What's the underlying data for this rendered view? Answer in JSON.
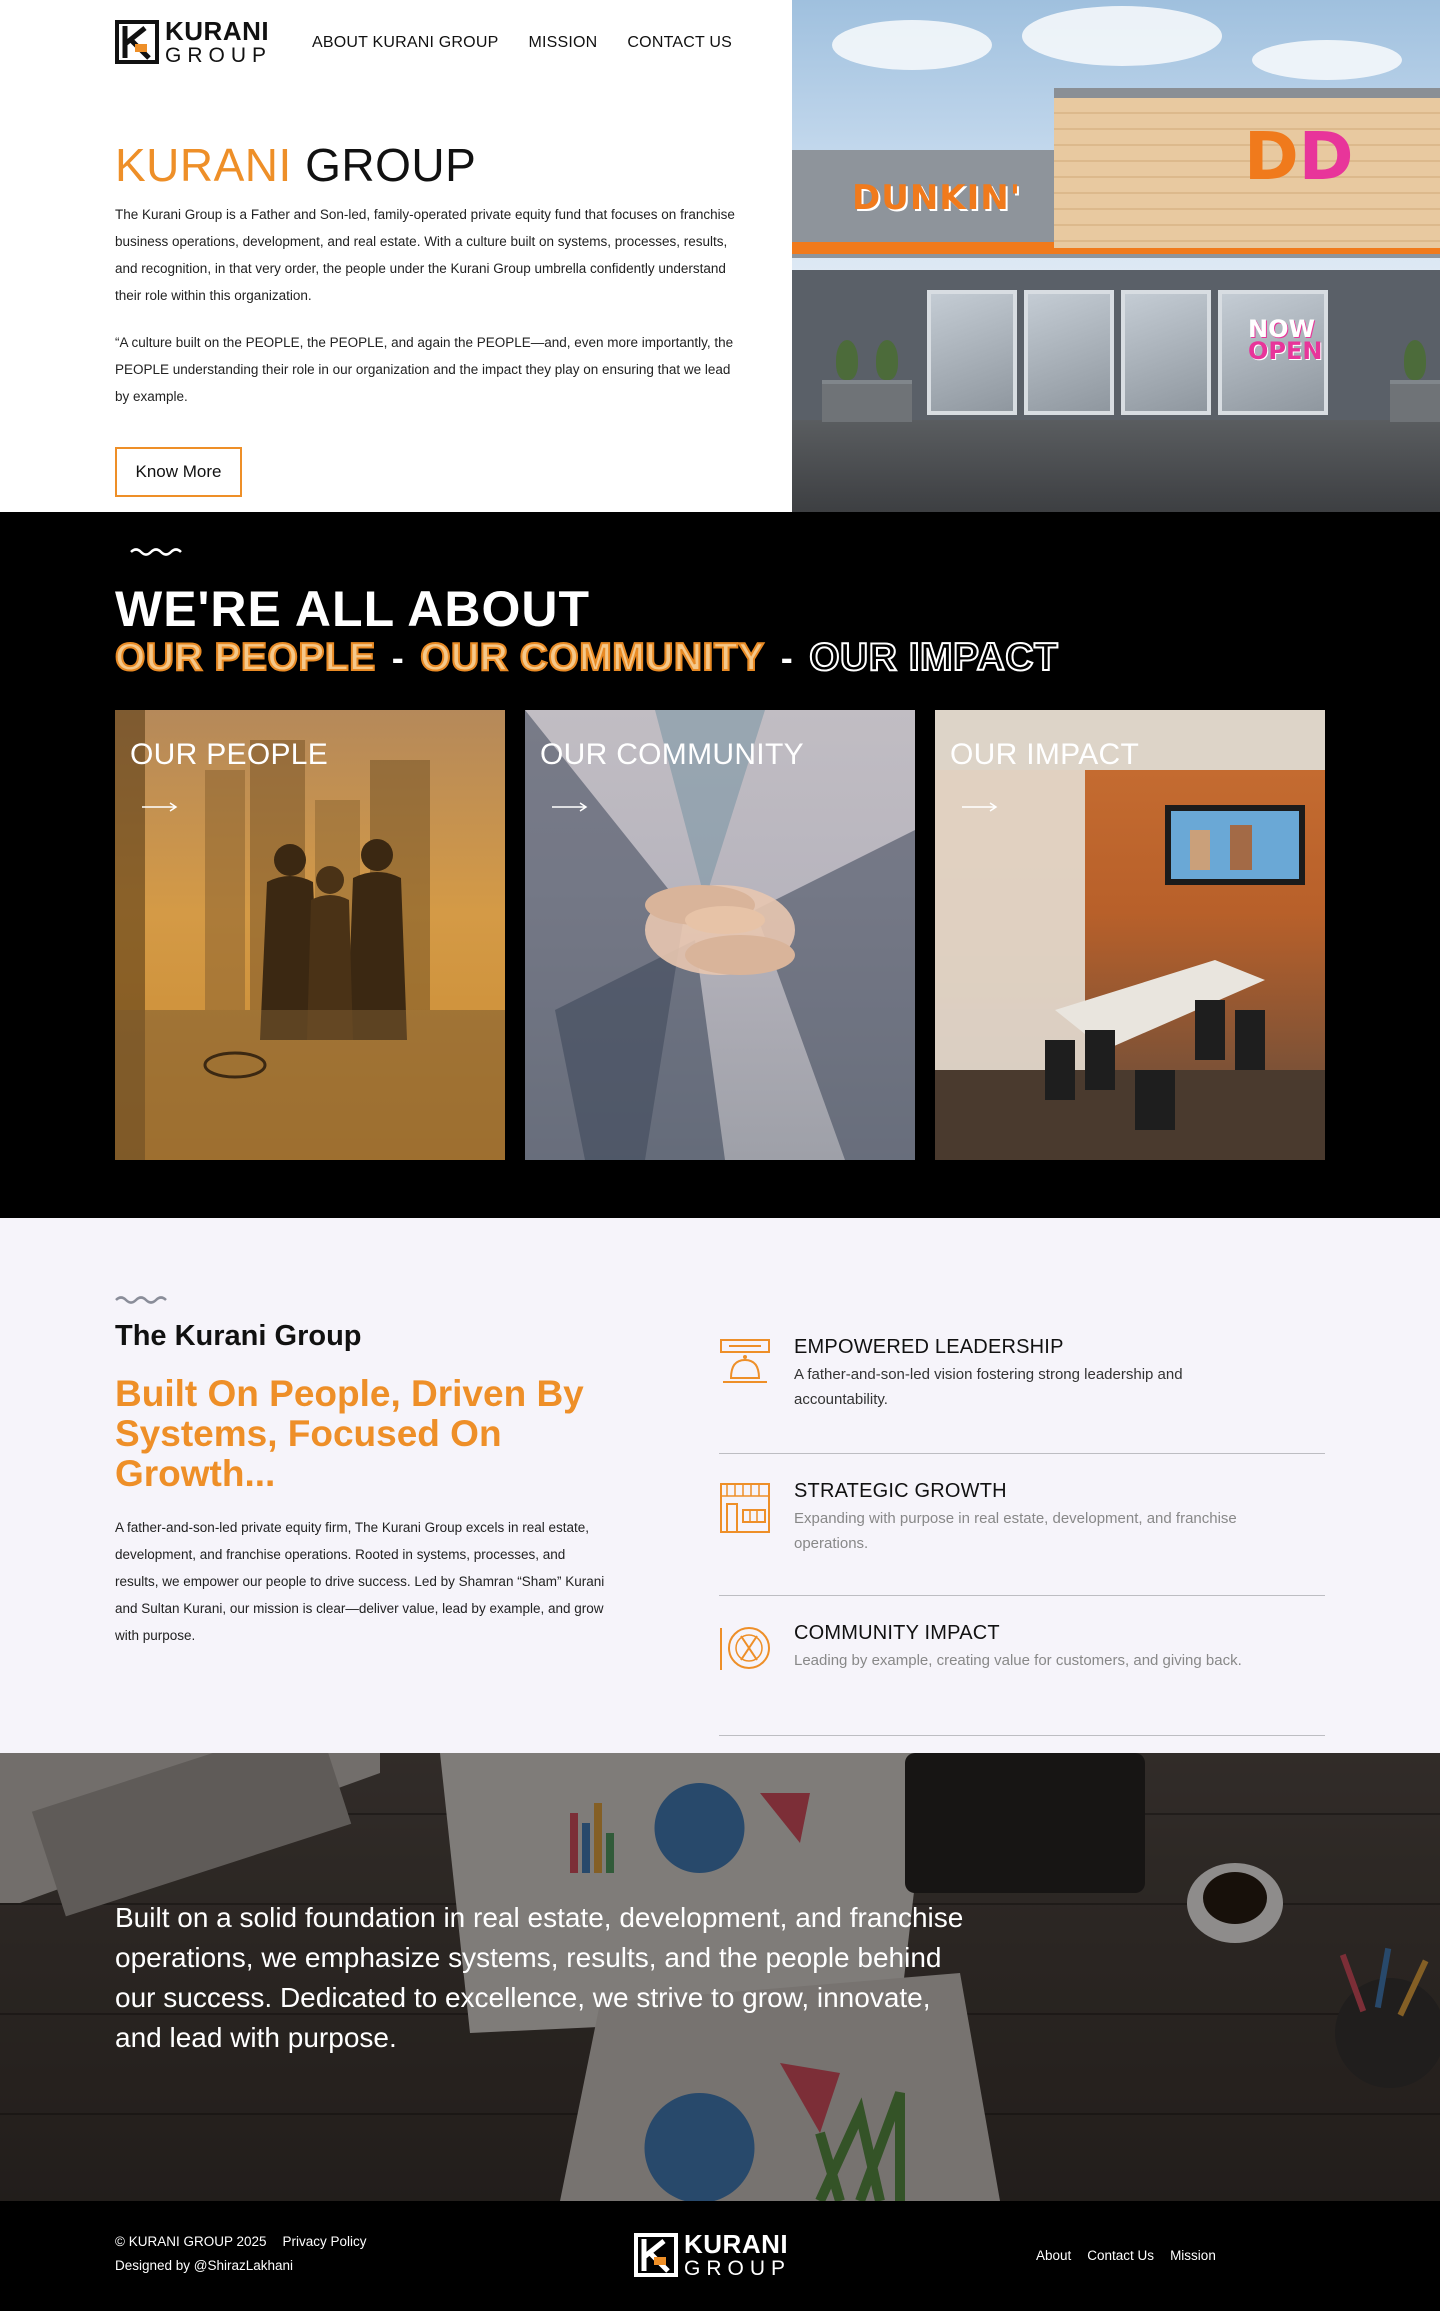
{
  "header": {
    "logo_line1": "KURANI",
    "logo_line2": "GROUP",
    "nav": [
      "ABOUT KURANI GROUP",
      "MISSION",
      "CONTACT US"
    ]
  },
  "hero": {
    "title_accent": "KURANI",
    "title_rest": "GROUP",
    "paragraph1": "The Kurani Group is a Father and Son-led, family-operated private equity fund that focuses on franchise business operations, development, and real estate. With a culture built on systems, processes, results, and recognition, in that very order, the people under the Kurani Group umbrella confidently understand their role within this organization.",
    "paragraph2": "“A culture built on the PEOPLE, the PEOPLE, and again the PEOPLE—and, even more importantly, the PEOPLE understanding their role in our organization and the impact they play on ensuring that we lead by example.",
    "button": "Know More",
    "image": {
      "store_sign": "DUNKIN'",
      "badge": "DD",
      "window_sign_1": "NOW",
      "window_sign_2": "OPEN"
    }
  },
  "about": {
    "heading": "WE'RE ALL ABOUT",
    "pillars": [
      "OUR PEOPLE",
      "OUR COMMUNITY",
      "OUR IMPACT"
    ],
    "separator": "-",
    "cards": [
      {
        "title": "OUR PEOPLE"
      },
      {
        "title": "OUR COMMUNITY"
      },
      {
        "title": "OUR IMPACT"
      }
    ]
  },
  "kurani_group": {
    "subtitle": "The Kurani Group",
    "title": "Built On People, Driven By Systems, Focused On Growth...",
    "paragraph": "A father-and-son-led private equity firm, The Kurani Group excels in real estate, development, and franchise operations. Rooted in systems, processes, and results, we empower our people to drive success. Led by Shamran “Sham” Kurani and Sultan Kurani, our mission is clear—deliver value, lead by example, and grow with purpose.",
    "features": [
      {
        "icon": "reception-bell-icon",
        "title": "EMPOWERED LEADERSHIP",
        "text": "A father-and-son-led vision fostering strong leadership and accountability."
      },
      {
        "icon": "storefront-icon",
        "title": "STRATEGIC GROWTH",
        "text": "Expanding with purpose in real estate, development, and franchise operations."
      },
      {
        "icon": "plate-cutlery-icon",
        "title": "COMMUNITY IMPACT",
        "text": "Leading by example, creating value for customers, and giving back."
      }
    ]
  },
  "banner": {
    "text": "Built on a solid foundation in real estate, development, and franchise operations, we emphasize systems, results, and the people behind our success. Dedicated to excellence, we strive to grow, innovate, and lead with purpose."
  },
  "footer": {
    "copyright": "© KURANI GROUP 2025",
    "privacy": "Privacy Policy",
    "designed_by": "Designed by @ShirazLakhani",
    "links": [
      "About",
      "Contact Us",
      "Mission"
    ]
  },
  "colors": {
    "accent": "#ee8f28",
    "dark": "#000000",
    "light_section": "#f6f4fa"
  }
}
